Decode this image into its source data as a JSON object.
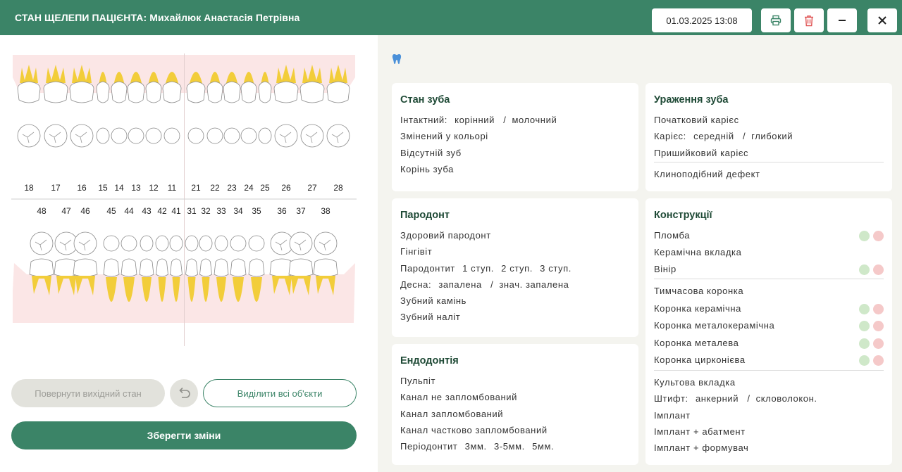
{
  "header": {
    "title": "СТАН ЩЕЛЕПИ ПАЦІЄНТА: Михайлюк Анастасія Петрівна",
    "datetime": "01.03.2025 13:08"
  },
  "upper_teeth": [
    "18",
    "17",
    "16",
    "15",
    "14",
    "13",
    "12",
    "11",
    "21",
    "22",
    "23",
    "24",
    "25",
    "26",
    "27",
    "28"
  ],
  "lower_teeth": [
    "48",
    "47",
    "46",
    "45",
    "44",
    "43",
    "42",
    "41",
    "31",
    "32",
    "33",
    "34",
    "35",
    "36",
    "37",
    "38"
  ],
  "buttons": {
    "restore": "Повернути вихідний стан",
    "select_all": "Виділити всі об'єкти",
    "save": "Зберегти зміни"
  },
  "cards": {
    "tooth_state": {
      "title": "Стан зуба",
      "intact": "Інтактний:",
      "intact_opt1": "корінний",
      "intact_opt2": "молочний",
      "items": [
        "Змінений у кольорі",
        "Відсутній зуб",
        "Корінь зуба"
      ]
    },
    "lesion": {
      "title": "Ураження зуба",
      "initial": "Початковий карієс",
      "caries": "Карієс:",
      "caries_opt1": "середній",
      "caries_opt2": "глибокий",
      "cervical": "Пришийковий карієс",
      "wedge": "Клиноподібний дефект"
    },
    "periodont": {
      "title": "Пародонт",
      "healthy": "Здоровий пародонт",
      "gingivitis": "Гінгівіт",
      "periodontitis": "Пародонтит",
      "p_opt1": "1 ступ.",
      "p_opt2": "2 ступ.",
      "p_opt3": "3 ступ.",
      "gum": "Десна:",
      "gum_opt1": "запалена",
      "gum_opt2": "знач. запалена",
      "calculus": "Зубний камінь",
      "plaque": "Зубний наліт"
    },
    "endo": {
      "title": "Ендодонтія",
      "items": [
        "Пульпіт",
        "Канал не запломбований",
        "Канал запломбований",
        "Канал частково запломбований"
      ],
      "periodontitis": "Періодонтит",
      "e_opt1": "3мм.",
      "e_opt2": "3-5мм.",
      "e_opt3": "5мм."
    },
    "constructions": {
      "title": "Конструкції",
      "filling": "Пломба",
      "inlay": "Керамічна вкладка",
      "veneer": "Вінір",
      "temp_crown": "Тимчасова коронка",
      "crown_ceramic": "Коронка керамічна",
      "crown_metal_ceramic": "Коронка металокерамічна",
      "crown_metal": "Коронка металева",
      "crown_zirconia": "Коронка цирконієва",
      "stump": "Культова вкладка",
      "pin": "Штифт:",
      "pin_opt1": "анкерний",
      "pin_opt2": "скловолокон.",
      "implant": "Імплант",
      "implant_abutment": "Імплант + абатмент",
      "implant_former": "Імплант + формувач"
    }
  },
  "colors": {
    "brand": "#3b8467",
    "root_yellow": "#f2cd3a",
    "gum_pink": "#fbe6e6",
    "ok_green": "#cfe8c9",
    "bad_red": "#f5c9c9",
    "tooth_icon_blue": "#4a90d9"
  }
}
